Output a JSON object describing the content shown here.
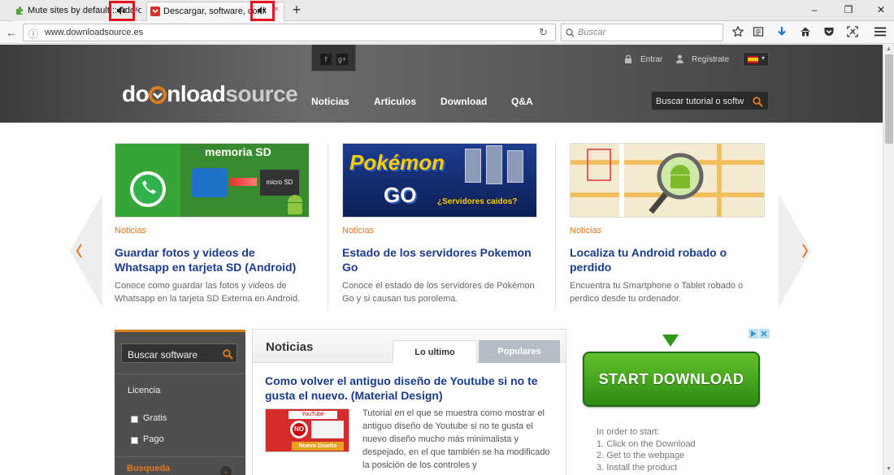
{
  "colors": {
    "accent": "#e07b1e",
    "link": "#1a3c8c",
    "highlight": "#e0141e",
    "download_green": "#2d8a15"
  },
  "browser": {
    "tabs": [
      {
        "title": "Mute sites by default :: Add-ons fo",
        "close": "×",
        "state": "inactive",
        "icon": "puzzle-green-icon",
        "audio_icon": "muted-speaker-icon"
      },
      {
        "title": "Descargar, software, conf",
        "close": "×",
        "state": "active",
        "icon": "downloadsource-icon",
        "audio_icon": "muted-speaker-icon"
      }
    ],
    "new_tab": "+",
    "window_controls": {
      "minimize": "–",
      "restore": "❐",
      "close": "✕"
    },
    "nav": {
      "back": "←",
      "info": "ⓘ",
      "reload": "↻"
    },
    "url": "www.downloadsource.es",
    "search_placeholder": "Buscar",
    "toolbar_icons": [
      "star-icon",
      "reading-list-icon",
      "download-arrow-icon",
      "home-icon",
      "pocket-icon",
      "screenshot-icon",
      "hamburger-menu-icon"
    ]
  },
  "site": {
    "logo": {
      "part1": "do",
      "part2": "nload",
      "part3": "source"
    },
    "social": [
      "f",
      "g+"
    ],
    "top_links": {
      "login": "Entrar",
      "register": "Regístrate"
    },
    "menu": [
      "Noticias",
      "Articulos",
      "Download",
      "Q&A"
    ],
    "search_placeholder": "Buscar tutorial o softw",
    "carousel": [
      {
        "category": "Noticias",
        "title": "Guardar fotos y videos de Whatsapp en tarjeta SD (Android)",
        "desc": "Conoce como guardar las fotos y videos de Whatsapp en la tarjeta SD Externa en Android.",
        "thumb_text": "memoria SD",
        "thumb_sub": "micro SD"
      },
      {
        "category": "Noticias",
        "title": "Estado de los servidores Pokemon Go",
        "desc": "Conoce el estado de los servidores de Pokémon Go y si causan tus porolema.",
        "thumb_text": "Pokémon",
        "thumb_sub": "GO",
        "thumb_note": "¿Servidores caidos?"
      },
      {
        "category": "Noticias",
        "title": "Localiza tu Android robado o perdido",
        "desc": "Encuentra tu Smartphone o Tablet robado o perdico desde tu ordenador.",
        "thumb_text": ""
      }
    ],
    "sidebar": {
      "search_placeholder": "Buscar software",
      "license_label": "Licencia",
      "options": [
        "Gratis",
        "Pago"
      ],
      "advanced": "Busqueda avanzada"
    },
    "news": {
      "heading": "Noticias",
      "tabs": [
        {
          "label": "Lo ultimo",
          "active": true
        },
        {
          "label": "Populares",
          "active": false
        }
      ],
      "article_title": "Como volver el antiguo diseño de Youtube si no te gusta el nuevo. (Material Design)",
      "article_text": "Tutorial en el que se muestra como mostrar el antiguo diseño de Youtube si no te gusta el nuevo diseño mucho más minimalista y despejado, en el que también se ha modificado la posición de los controles y",
      "thumb_labels": {
        "top": "YouTube",
        "no": "NO",
        "bottom": "Nuevo Diseño"
      }
    },
    "ad": {
      "button": "START DOWNLOAD",
      "info": [
        "In order to start:",
        "1. Click on the Download",
        "2. Get to the webpage",
        "3. Install the product"
      ]
    }
  }
}
